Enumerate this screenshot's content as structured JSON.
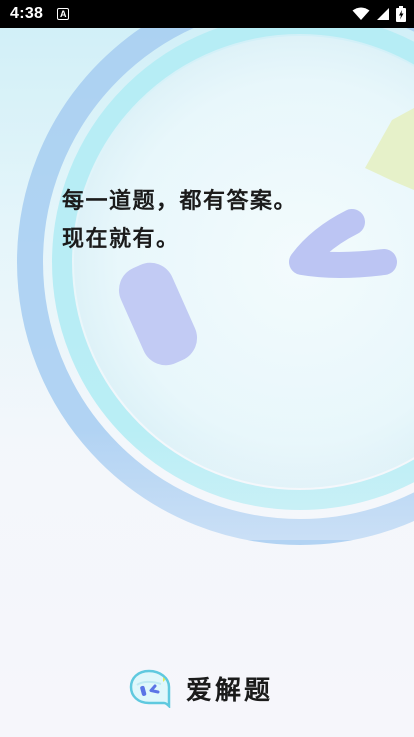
{
  "status_bar": {
    "time": "4:38",
    "notification_icon": "A",
    "icons": [
      "wifi-icon",
      "signal-icon",
      "battery-icon"
    ]
  },
  "slogan": {
    "line1": "每一道题，都有答案。",
    "line2": "现在就有。"
  },
  "brand": {
    "name": "爱解题",
    "logo_icon": "speech-bubble-face-icon"
  },
  "colors": {
    "accent_blue": "#8fa2ee",
    "ring_blue": "#9fcaf0",
    "ring_cyan": "#aaeaf3",
    "star_yellow": "#e7efc4",
    "text": "#1b1b1b"
  }
}
